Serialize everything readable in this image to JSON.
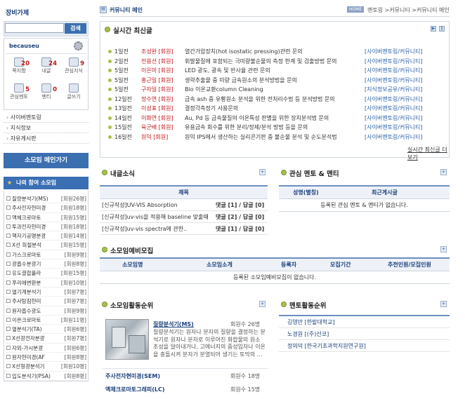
{
  "left": {
    "title": "장비가제",
    "search_btn": "검색",
    "username": "becauseu",
    "stats": [
      {
        "label": "쪽지함",
        "count": "20",
        "color": "#c4161c"
      },
      {
        "label": "내글",
        "count": "24",
        "color": "#c4161c"
      },
      {
        "label": "관심지식",
        "count": "9",
        "color": "#c4161c"
      },
      {
        "label": "관심멘토",
        "count": "5",
        "color": "#c4161c"
      },
      {
        "label": "멘티",
        "count": "0",
        "color": "#c4161c"
      },
      {
        "label": "글쓰기",
        "count": "",
        "color": "#c4161c"
      }
    ],
    "menu": [
      "사이버멘토링",
      "지식정보",
      "자유게시판"
    ],
    "go_btn": "소모임 메인가기",
    "my_groups_title": "나의 참여 소모임",
    "groups": [
      {
        "name": "질량분석기(MS)",
        "count": "[회원26명]"
      },
      {
        "name": "주사전자현미경",
        "count": "[회원18명]"
      },
      {
        "name": "액체크로마토",
        "count": "[회원15명]"
      },
      {
        "name": "투과전자현미경",
        "count": "[회원18명]"
      },
      {
        "name": "핵자기공명분광",
        "count": "[회원14명]"
      },
      {
        "name": "X선 회절분석",
        "count": "[회원15명]"
      },
      {
        "name": "가스크로마토",
        "count": "[회원9명]"
      },
      {
        "name": "광흡수분광기",
        "count": "[회원8명]"
      },
      {
        "name": "유도결합플라",
        "count": "[회원15명]"
      },
      {
        "name": "푸리에변환분",
        "count": "[회원10명]"
      },
      {
        "name": "열기계분석기",
        "count": "[회원7명]"
      },
      {
        "name": "주사탐침현미",
        "count": "[회원7명]"
      },
      {
        "name": "원자흡수광도",
        "count": "[회원9명]"
      },
      {
        "name": "이온크로마토",
        "count": "[회원11명]"
      },
      {
        "name": "열분석기(TA)",
        "count": "[회원6명]"
      },
      {
        "name": "X선광전자분광",
        "count": "[회원7명]"
      },
      {
        "name": "자외-가시분광",
        "count": "[회원6명]"
      },
      {
        "name": "원자현미경(AF",
        "count": "[회원8명]"
      },
      {
        "name": "X선형광분석기",
        "count": "[회원10명]"
      },
      {
        "name": "입도분석기(PSA)",
        "count": "[회원8명]"
      }
    ]
  },
  "header": {
    "title": "커뮤니티 메인",
    "home": "HOME",
    "breadcrumb": "멘토링 >커뮤니티 >커뮤니티 메인"
  },
  "latest": {
    "title": "실시간 최신글",
    "more": "실시간 최신글 더보기",
    "rows": [
      {
        "time": "1일전",
        "author": "조성완 [회원]",
        "text": "열간가압장치(hot isostatic pressing)관련 문의",
        "cat": "[사이버멘토링/커뮤니티]"
      },
      {
        "time": "2일전",
        "author": "전용선 [회원]",
        "text": "휘발물질에 포함되는 극미량불순물의 측정 한계 및 검출방법 문의",
        "cat": "[사이버멘토링/커뮤니티]"
      },
      {
        "time": "5일전",
        "author": "이은미 [회원]",
        "text": "LED 광도, 광속 및 반사율 관련 문의",
        "cat": "[사이버멘토링/커뮤니티]"
      },
      {
        "time": "5일전",
        "author": "홍근일 [회원]",
        "text": "생략추출물 중 미량 금속원소의 분석방법을 문의",
        "cat": "[사이버멘토링/커뮤니티]"
      },
      {
        "time": "5일전",
        "author": "구자일 [회원]",
        "text": "Bio 이온교환column Cleaning",
        "cat": "[지식정보공유/커뮤니티]"
      },
      {
        "time": "12일전",
        "author": "정수연 [회원]",
        "text": "금속 ash 중 유황원소 분석을 위한 전처리수법 등 분석방법 문의",
        "cat": "[사이버멘토링/커뮤니티]"
      },
      {
        "time": "13일전",
        "author": "이성표 [회원]",
        "text": "결정각측정기 사용문의",
        "cat": "[사이버멘토링/커뮤니티]"
      },
      {
        "time": "14일전",
        "author": "이화연 [회원]",
        "text": "Au, Pd 등 금속물질의 이온특성 판별을 위한 장치분석법 문의",
        "cat": "[사이버멘토링/커뮤니티]"
      },
      {
        "time": "15일전",
        "author": "육군배 [회원]",
        "text": "유용금속 회수를 위한 분리/정제/분석 방법 등을 문의",
        "cat": "[사이버멘토링/커뮤니티]"
      },
      {
        "time": "16일전",
        "author": "원익 [회원]",
        "text": "원익 IPS에서 생산하는 실리콘기판 중 불순물 분석 및 순도분석법",
        "cat": "[사이버멘토링/커뮤니티]"
      }
    ]
  },
  "my_posts": {
    "title": "내글소식",
    "col": "제목",
    "rows": [
      {
        "title": "[신규작성]UV-VIS Absorption",
        "stat": "댓글 [1] / 답글 [0]"
      },
      {
        "title": "[신규작성]uv-vis을 적용해 baseline 맞출때",
        "stat": "댓글 [2] / 답글 [0]"
      },
      {
        "title": "[신규작성]uv-vis spectra에 관한..",
        "stat": "댓글 [1] / 답글 [0]"
      }
    ]
  },
  "interest": {
    "title": "관심 멘토 & 멘티",
    "cols": [
      "성명(별칭)",
      "최근게시글"
    ],
    "empty": "등록된 관심 멘토 & 멘티가 없습니다."
  },
  "recruit": {
    "title": "소모임예비모집",
    "cols": [
      "소모임명",
      "소모임소개",
      "등록자",
      "모집기간",
      "추천인원/모집인원"
    ],
    "empty": "등록된 소모임예비모집이 없습니다."
  },
  "ranking": {
    "title": "소모임활동순위",
    "top": {
      "name": "질량분석기(MS)",
      "members": "회원수 26명",
      "desc": "질량분석기는 원자나 분자의 질량을 결정하는 분석기로 원자나 분자로 이루어진 화합물의 원소 조성을 알아내거나, 고에너지의 중성입자나 이온을 충돌시켜 분자가 분열되어 생기는 토막의 ..."
    },
    "others": [
      {
        "name": "주사전자현미경(SEM)",
        "members": "회원수 18명"
      },
      {
        "name": "액체크로마토그래피(LC)",
        "members": "회원수 15명"
      }
    ]
  },
  "mentor_rank": {
    "title": "멘토활동순위",
    "items": [
      "김영만 [한밭대학교]",
      "노경원 [(주)선코]",
      "정의덕 [한국기초과학지원연구원]"
    ]
  }
}
